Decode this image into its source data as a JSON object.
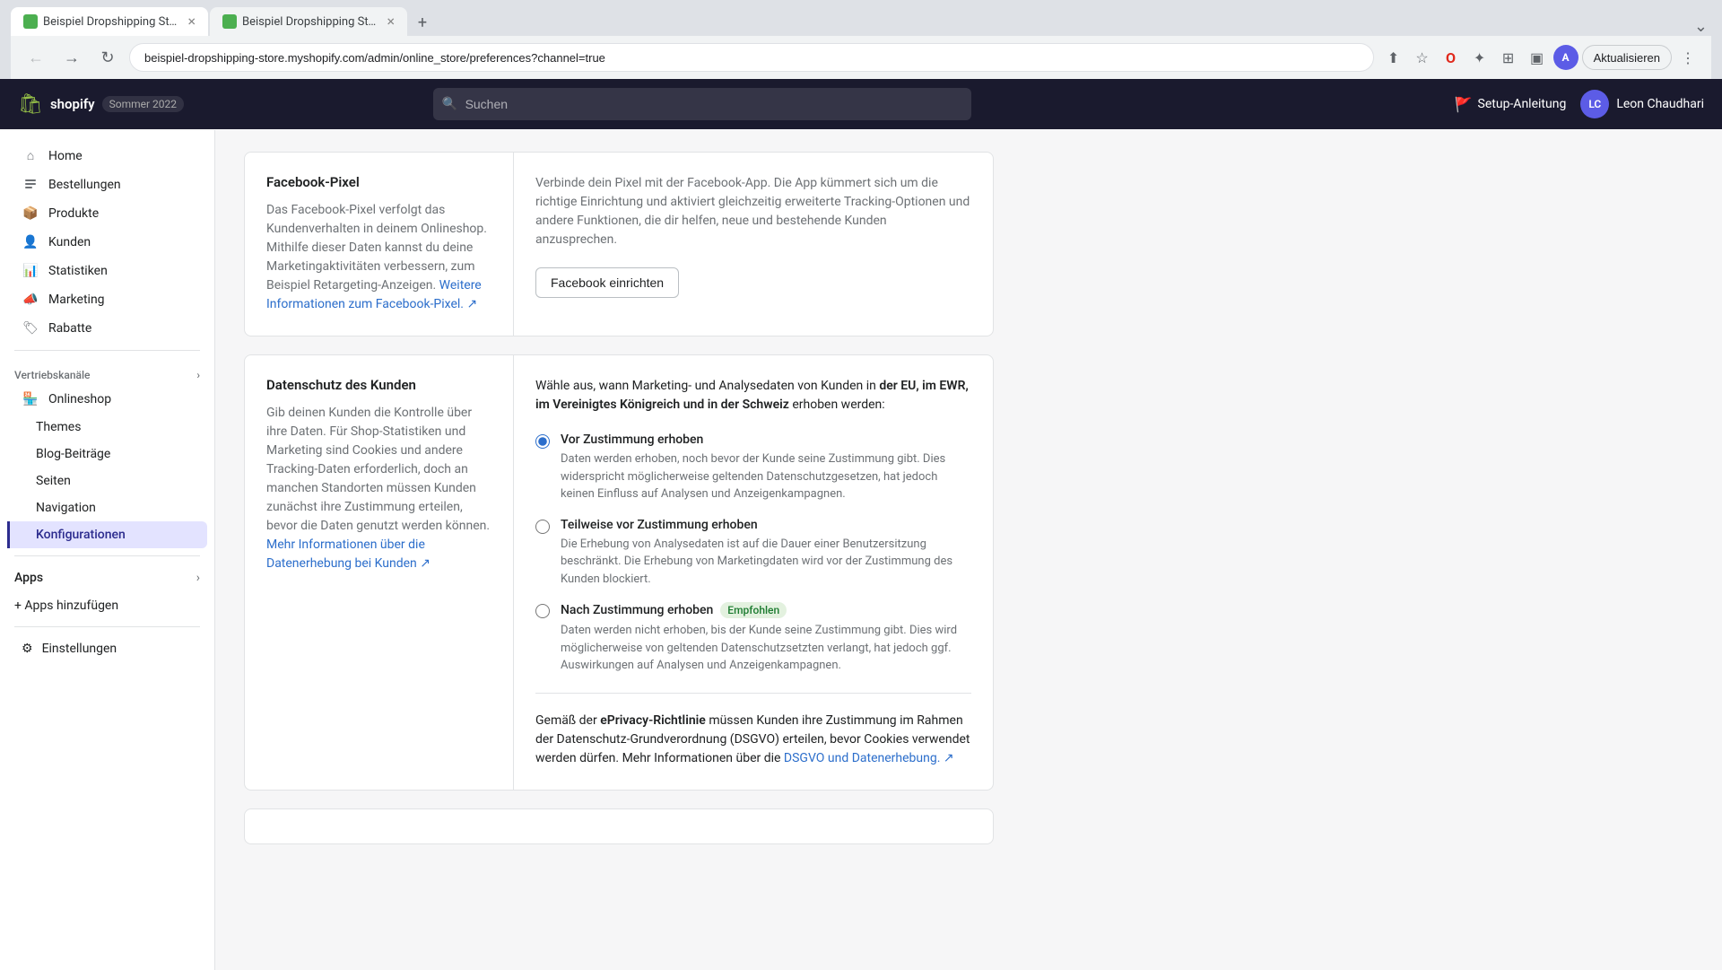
{
  "browser": {
    "tabs": [
      {
        "id": "tab1",
        "title": "Beispiel Dropshipping Store ·...",
        "active": true,
        "favicon_color": "#4CAF50"
      },
      {
        "id": "tab2",
        "title": "Beispiel Dropshipping Store",
        "active": false,
        "favicon_color": "#4CAF50"
      }
    ],
    "new_tab_label": "+",
    "url": "beispiel-dropshipping-store.myshopify.com/admin/online_store/preferences?channel=true",
    "update_button": "Aktualisieren"
  },
  "topbar": {
    "logo_icon": "🛍",
    "brand": "shopify",
    "season": "Sommer 2022",
    "search_placeholder": "Suchen",
    "setup_label": "Setup-Anleitung",
    "user_initials": "LC",
    "user_name": "Leon Chaudhari"
  },
  "sidebar": {
    "nav_items": [
      {
        "id": "home",
        "label": "Home",
        "icon": "house"
      },
      {
        "id": "orders",
        "label": "Bestellungen",
        "icon": "list"
      },
      {
        "id": "products",
        "label": "Produkte",
        "icon": "box"
      },
      {
        "id": "customers",
        "label": "Kunden",
        "icon": "person"
      },
      {
        "id": "analytics",
        "label": "Statistiken",
        "icon": "bar-chart"
      },
      {
        "id": "marketing",
        "label": "Marketing",
        "icon": "megaphone"
      },
      {
        "id": "discounts",
        "label": "Rabatte",
        "icon": "tag"
      }
    ],
    "sales_channels_label": "Vertriebskanäle",
    "online_store_label": "Onlineshop",
    "sub_items": [
      {
        "id": "themes",
        "label": "Themes",
        "active": false
      },
      {
        "id": "blog",
        "label": "Blog-Beiträge",
        "active": false
      },
      {
        "id": "pages",
        "label": "Seiten",
        "active": false
      },
      {
        "id": "navigation",
        "label": "Navigation",
        "active": false
      },
      {
        "id": "config",
        "label": "Konfigurationen",
        "active": true
      }
    ],
    "apps_label": "Apps",
    "add_apps_label": "+ Apps hinzufügen",
    "settings_label": "Einstellungen"
  },
  "main": {
    "facebook_pixel": {
      "title": "Facebook-Pixel",
      "description": "Das Facebook-Pixel verfolgt das Kundenverhalten in deinem Onlineshop. Mithilfe dieser Daten kannst du deine Marketingaktivitäten verbessern, zum Beispiel Retargeting-Anzeigen.",
      "link_text": "Weitere Informationen zum Facebook-Pixel.",
      "right_text": "Verbinde dein Pixel mit der Facebook-App. Die App kümmert sich um die richtige Einrichtung und aktiviert gleichzeitig erweiterte Tracking-Optionen und andere Funktionen, die dir helfen, neue und bestehende Kunden anzusprechen.",
      "button_label": "Facebook einrichten"
    },
    "privacy": {
      "title": "Datenschutz des Kunden",
      "description_parts": [
        "Gib deinen Kunden die Kontrolle über ihre Daten. Für Shop-Statistiken und Marketing sind Cookies und andere Tracking-Daten erforderlich, doch an manchen Standorten müssen Kunden zunächst ihre Zustimmung erteilen, bevor die Daten genutzt werden können."
      ],
      "link_text": "Mehr Informationen über die Datenerhebung bei Kunden",
      "right_intro": "Wähle aus, wann Marketing- und Analysedaten von Kunden in",
      "right_intro_bold": "der EU, im EWR, im Vereinigtes Königreich und in der Schweiz",
      "right_intro_end": "erhoben werden:",
      "options": [
        {
          "id": "before",
          "label": "Vor Zustimmung erhoben",
          "description": "Daten werden erhoben, noch bevor der Kunde seine Zustimmung gibt. Dies widerspricht möglicherweise geltenden Datenschutzgesetzen, hat jedoch keinen Einfluss auf Analysen und Anzeigenkampagnen.",
          "checked": true,
          "badge": null
        },
        {
          "id": "partial",
          "label": "Teilweise vor Zustimmung erhoben",
          "description": "Die Erhebung von Analysedaten ist auf die Dauer einer Benutzersitzung beschränkt. Die Erhebung von Marketingdaten wird vor der Zustimmung des Kunden blockiert.",
          "checked": false,
          "badge": null
        },
        {
          "id": "after",
          "label": "Nach Zustimmung erhoben",
          "description": "Daten werden nicht erhoben, bis der Kunde seine Zustimmung gibt. Dies wird möglicherweise von geltenden Datenschutzsetzten verlangt, hat jedoch ggf. Auswirkungen auf Analysen und Anzeigenkampagnen.",
          "checked": false,
          "badge": "Empfohlen"
        }
      ],
      "eprivacy_text_1": "Gemäß der",
      "eprivacy_bold": "ePrivacy-Richtlinie",
      "eprivacy_text_2": "müssen Kunden ihre Zustimmung im Rahmen der Datenschutz-Grundverordnung (DSGVO) erteilen, bevor Cookies verwendet werden dürfen. Mehr Informationen über die",
      "eprivacy_link": "DSGVO und Datenerhebung.",
      "eprivacy_link_icon": "↗"
    }
  }
}
